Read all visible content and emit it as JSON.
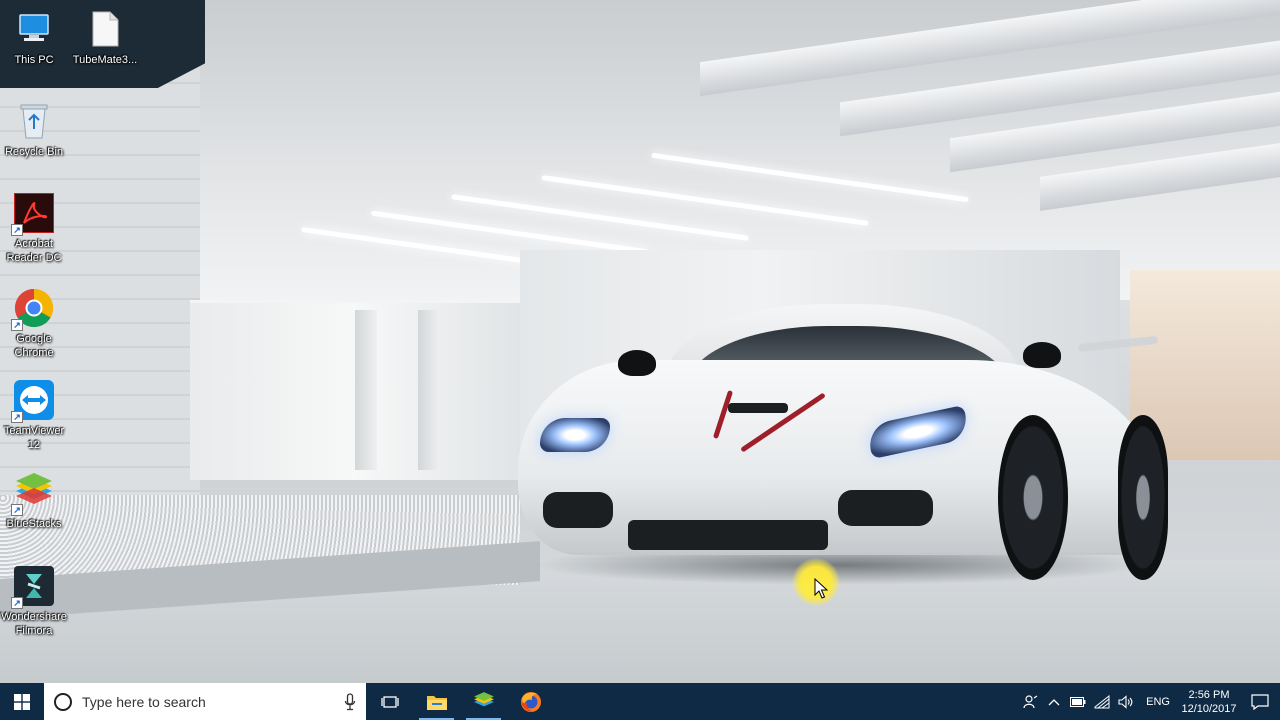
{
  "desktop": {
    "icons": [
      {
        "label": "This PC",
        "icon": "this-pc-icon"
      },
      {
        "label": "TubeMate3...",
        "icon": "file-icon"
      },
      {
        "label": "Recycle Bin",
        "icon": "recycle-bin-icon"
      },
      {
        "label": "Acrobat\nReader DC",
        "icon": "acrobat-icon"
      },
      {
        "label": "Google\nChrome",
        "icon": "chrome-icon"
      },
      {
        "label": "TeamViewer\n12",
        "icon": "teamviewer-icon"
      },
      {
        "label": "BlueStacks",
        "icon": "bluestacks-icon"
      },
      {
        "label": "Wondershare\nFilmora",
        "icon": "filmora-icon"
      }
    ]
  },
  "taskbar": {
    "search_placeholder": "Type here to search",
    "pinned": [
      "file-explorer-icon",
      "bluestacks-icon",
      "firefox-icon"
    ],
    "tray": {
      "language": "ENG",
      "time": "2:56 PM",
      "date": "12/10/2017"
    }
  },
  "colors": {
    "taskbar_bg": "#0f2a44",
    "accent": "#0078d7"
  }
}
